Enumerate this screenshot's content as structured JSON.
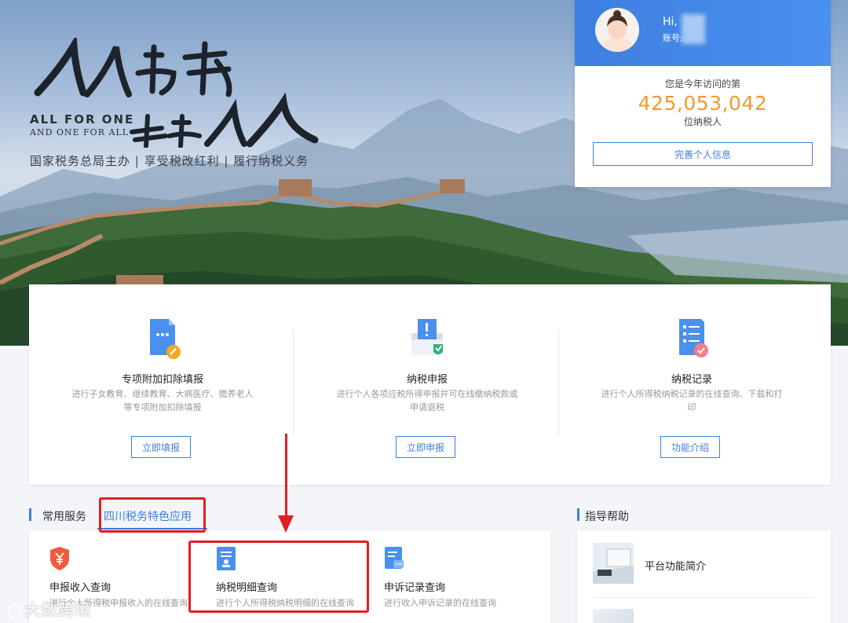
{
  "hero": {
    "calligraphy_top": "人人为我",
    "calligraphy_bottom": "我为人人",
    "slogan_en_1": "ALL  FOR  ONE",
    "slogan_en_2": "AND ONE FOR ALL",
    "subtitle": "国家税务总局主办 | 享受税改红利 | 履行纳税义务"
  },
  "user": {
    "greeting": "Hi,",
    "account_label": "账号:",
    "visit_prefix": "您是今年访问的第",
    "visit_count": "425,053,042",
    "visit_suffix": "位纳税人",
    "complete_button": "完善个人信息"
  },
  "services": [
    {
      "title": "专项附加扣除填报",
      "desc": "进行子女教育、继续教育、大病医疗、赡养老人等专项附加扣除填报",
      "button": "立即填报",
      "icon": "document-edit-icon"
    },
    {
      "title": "纳税申报",
      "desc": "进行个人各项应税所得申报并可在线缴纳税款或申请退税",
      "button": "立即申报",
      "icon": "tax-declare-icon"
    },
    {
      "title": "纳税记录",
      "desc": "进行个人所得税纳税记录的在线查询、下载和打印",
      "button": "功能介绍",
      "icon": "tax-record-icon"
    }
  ],
  "tabs": {
    "common": "常用服务",
    "sichuan": "四川税务特色应用",
    "help": "指导帮助"
  },
  "common_items": [
    {
      "title": "申报收入查询",
      "desc": "进行个人所得税申报收入的在线查询",
      "icon": "shield-yen-icon"
    },
    {
      "title": "纳税明细查询",
      "desc": "进行个人所得税纳税明细的在线查询",
      "icon": "tax-detail-icon"
    },
    {
      "title": "申诉记录查询",
      "desc": "进行收入申诉记录的在线查询",
      "icon": "appeal-record-icon"
    }
  ],
  "help_items": [
    {
      "label": "平台功能简介"
    },
    {
      "label": ""
    }
  ],
  "watermark": "大数跨境",
  "colors": {
    "accent": "#3d7fe0",
    "visit_count": "#f29a2e",
    "annotation": "#e02020"
  }
}
